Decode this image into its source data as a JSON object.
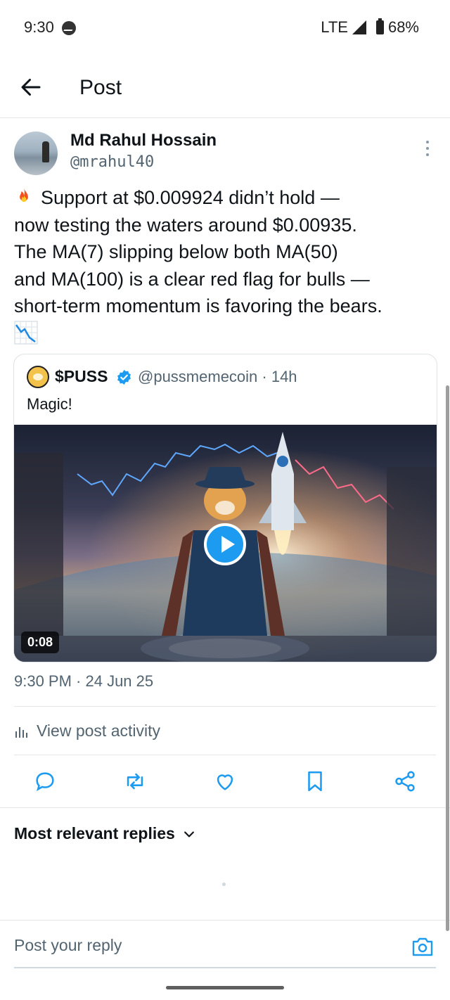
{
  "status_bar": {
    "time": "9:30",
    "network": "LTE",
    "battery": "68%"
  },
  "header": {
    "title": "Post"
  },
  "post": {
    "author_name": "Md Rahul Hossain",
    "author_handle": "@mrahul40",
    "text_lines": [
      "Support at $0.009924 didn’t hold —",
      "now testing the waters around $0.00935.",
      "The MA(7) slipping below both MA(50)",
      "and MA(100) is a clear red flag for bulls —",
      "short-term momentum is favoring the bears."
    ],
    "timestamp": "9:30 PM · 24 Jun 25",
    "view_activity": "View post activity"
  },
  "quote": {
    "name": "$PUSS",
    "handle_time": "@pussmemecoin · 14h",
    "text": "Magic!",
    "video_duration": "0:08"
  },
  "replies": {
    "sort_label": "Most relevant replies"
  },
  "reply_box": {
    "placeholder": "Post your reply"
  },
  "colors": {
    "accent": "#1d9bf0",
    "text": "#0f1419",
    "secondary": "#536471"
  },
  "icons": [
    "back-arrow-icon",
    "more-vertical-icon",
    "fire-emoji-icon",
    "chart-decreasing-emoji-icon",
    "verified-badge-icon",
    "play-icon",
    "stats-icon",
    "reply-icon",
    "repost-icon",
    "like-icon",
    "bookmark-icon",
    "share-icon",
    "chevron-down-icon",
    "camera-icon"
  ]
}
